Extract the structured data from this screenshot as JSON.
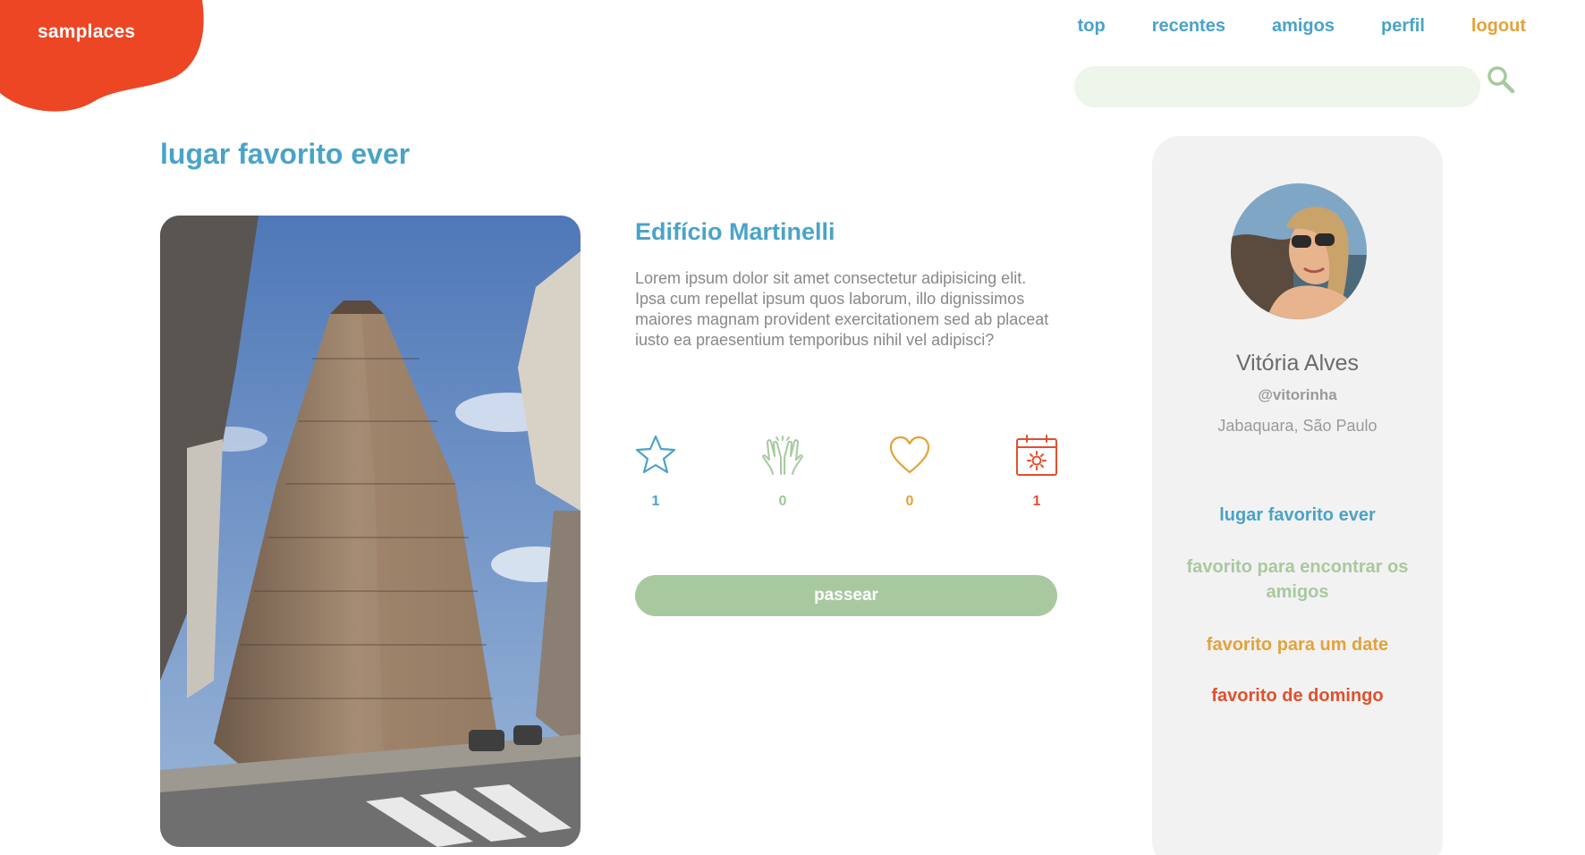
{
  "brand": {
    "name": "samplaces",
    "color": "#ec4625"
  },
  "nav": {
    "top": "top",
    "recentes": "recentes",
    "amigos": "amigos",
    "perfil": "perfil",
    "logout": "logout"
  },
  "search": {
    "placeholder": "",
    "value": ""
  },
  "page": {
    "title": "lugar favorito ever"
  },
  "place": {
    "name": "Edifício Martinelli",
    "description": "Lorem ipsum dolor sit amet consectetur adipisicing elit. Ipsa cum repellat ipsum quos laborum, illo dignissimos maiores magnam provident exercitationem sed ab placeat iusto ea praesentium temporibus nihil vel adipisci?",
    "ratings": {
      "star": {
        "icon": "star-icon",
        "count": "1",
        "color": "#4aa3c8"
      },
      "hands": {
        "icon": "high-five-icon",
        "count": "0",
        "color": "#9dc79a"
      },
      "heart": {
        "icon": "heart-icon",
        "count": "0",
        "color": "#e3a23a"
      },
      "calendar": {
        "icon": "calendar-sun-icon",
        "count": "1",
        "color": "#e0502d"
      }
    },
    "action_label": "passear"
  },
  "profile": {
    "name": "Vitória Alves",
    "handle": "@vitorinha",
    "location": "Jabaquara, São Paulo",
    "links": [
      "lugar favorito ever",
      "favorito para encontrar os amigos",
      "favorito para um date",
      "favorito de domingo"
    ]
  },
  "colors": {
    "blue": "#4aa3c8",
    "green": "#a8c99f",
    "yellow": "#e3a23a",
    "red": "#e0502d",
    "panel": "#f2f2f2"
  }
}
